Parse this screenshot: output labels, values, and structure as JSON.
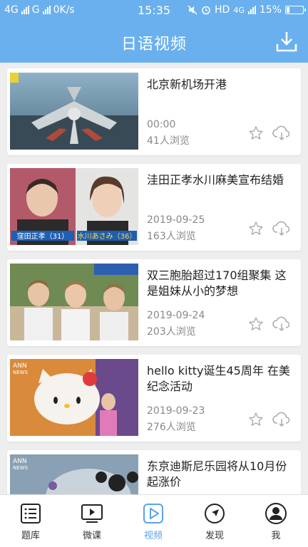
{
  "status_bar": {
    "net_1": "4G",
    "net_2": "G",
    "speed": "0K/s",
    "time": "15:35",
    "hd": "HD",
    "net_3": "4G",
    "battery": "15%"
  },
  "header": {
    "title": "日语视频",
    "download_icon": "download-icon"
  },
  "videos": [
    {
      "title": "北京新机场开港",
      "date": "00:00",
      "views": "41人浏览"
    },
    {
      "title": "洼田正孝水川麻美宣布结婚",
      "date": "2019-09-25",
      "views": "163人浏览"
    },
    {
      "title": "双三胞胎超过170组聚集 这是姐妹从小的梦想",
      "date": "2019-09-24",
      "views": "203人浏览"
    },
    {
      "title": "hello kitty诞生45周年 在美纪念活动",
      "date": "2019-09-23",
      "views": "276人浏览"
    },
    {
      "title": "东京迪斯尼乐园将从10月份起涨价",
      "date": "",
      "views": ""
    }
  ],
  "thumb_captions": {
    "v2_left": "窪田正孝（31）",
    "v2_right": "水川あさみ（36）",
    "v4_logo": "ANN",
    "v4_sub": "NEWS",
    "v5_logo": "ANN",
    "v5_sub": "NEWS"
  },
  "tabs": [
    {
      "label": "题库",
      "icon": "list-icon"
    },
    {
      "label": "微课",
      "icon": "monitor-play-icon"
    },
    {
      "label": "视频",
      "icon": "video-play-icon",
      "active": true
    },
    {
      "label": "发现",
      "icon": "compass-icon"
    },
    {
      "label": "我",
      "icon": "user-icon"
    }
  ],
  "colors": {
    "header": "#6ab0ee",
    "tab_active": "#5aa2ea",
    "icon_gray": "#aaaaaa"
  }
}
